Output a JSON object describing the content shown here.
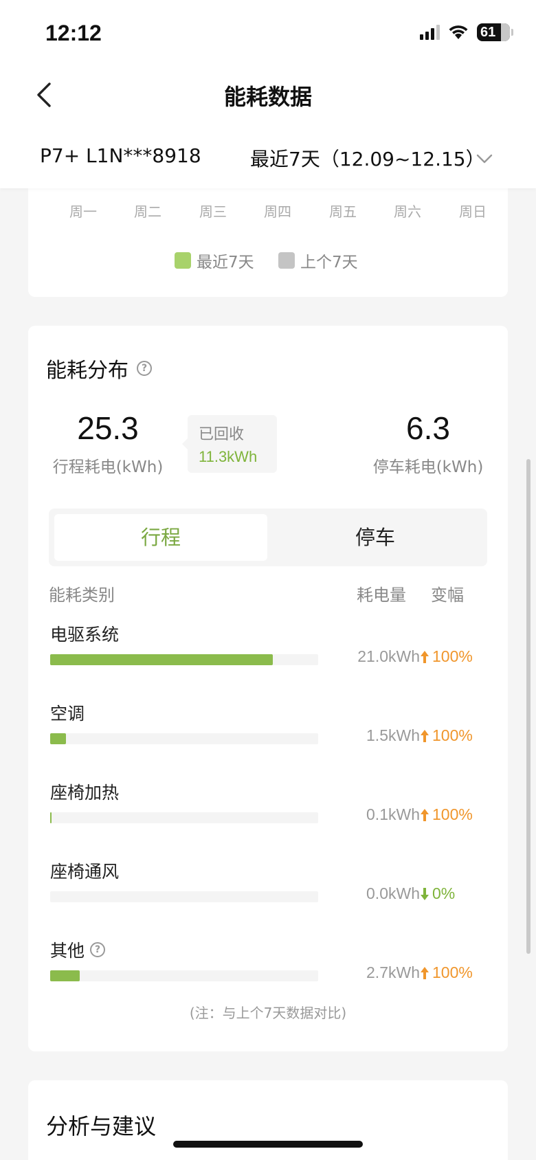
{
  "status_bar": {
    "time": "12:12",
    "battery": "61"
  },
  "nav": {
    "title": "能耗数据"
  },
  "filter": {
    "vehicle": "P7+ L1N***8918",
    "period": "最近7天（12.09~12.15）"
  },
  "week_chart": {
    "weekdays": [
      "周一",
      "周二",
      "周三",
      "周四",
      "周五",
      "周六",
      "周日"
    ],
    "legend_current": "最近7天",
    "legend_previous": "上个7天",
    "color_current": "#a8d26b",
    "color_previous": "#c4c4c4"
  },
  "distribution": {
    "title": "能耗分布",
    "trip_value": "25.3",
    "trip_label": "行程耗电(kWh)",
    "recovered_label": "已回收",
    "recovered_value": "11.3kWh",
    "park_value": "6.3",
    "park_label": "停车耗电(kWh)",
    "tabs": {
      "trip": "行程",
      "park": "停车"
    },
    "headers": {
      "category": "能耗类别",
      "consumption": "耗电量",
      "change": "变幅"
    },
    "rows": [
      {
        "label": "电驱系统",
        "value": "21.0kWh",
        "change": "100%",
        "direction": "up",
        "fraction": 0.83,
        "help": false
      },
      {
        "label": "空调",
        "value": "1.5kWh",
        "change": "100%",
        "direction": "up",
        "fraction": 0.06,
        "help": false
      },
      {
        "label": "座椅加热",
        "value": "0.1kWh",
        "change": "100%",
        "direction": "up",
        "fraction": 0.005,
        "help": false
      },
      {
        "label": "座椅通风",
        "value": "0.0kWh",
        "change": "0%",
        "direction": "down",
        "fraction": 0.0,
        "help": false
      },
      {
        "label": "其他",
        "value": "2.7kWh",
        "change": "100%",
        "direction": "up",
        "fraction": 0.11,
        "help": true
      }
    ],
    "note": "(注：与上个7天数据对比)",
    "accent_color": "#8bbb4c",
    "up_color": "#f0962c",
    "down_color": "#7fb43b"
  },
  "analysis": {
    "title": "分析与建议"
  }
}
